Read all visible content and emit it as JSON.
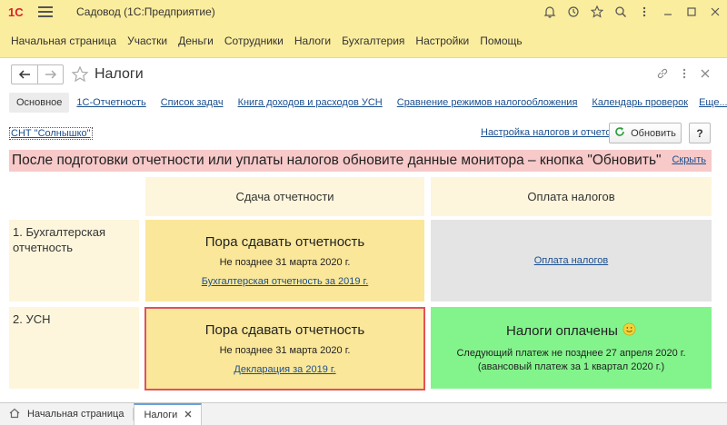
{
  "app": {
    "title": "Садовод  (1С:Предприятие)",
    "logo": "1C"
  },
  "section_nav": [
    "Начальная страница",
    "Участки",
    "Деньги",
    "Сотрудники",
    "Налоги",
    "Бухгалтерия",
    "Настройки",
    "Помощь"
  ],
  "form": {
    "title": "Налоги",
    "tabs": [
      {
        "label": "Основное",
        "active": true
      },
      {
        "label": "1С-Отчетность"
      },
      {
        "label": "Список задач"
      },
      {
        "label": "Книга доходов и расходов УСН"
      },
      {
        "label": "Сравнение режимов налогообложения"
      },
      {
        "label": "Календарь проверок"
      }
    ],
    "more_label": "Еще...",
    "organization": "СНТ \"Солнышко\"",
    "setup_link": "Настройка налогов и отчетов",
    "refresh_label": "Обновить",
    "help_label": "?"
  },
  "notice": {
    "text": "После подготовки отчетности или уплаты налогов обновите данные монитора – кнопка \"Обновить\"",
    "hide_label": "Скрыть",
    "color": "#f7c9c9"
  },
  "monitor": {
    "columns": [
      "Сдача отчетности",
      "Оплата налогов"
    ],
    "rows": [
      {
        "label": "1. Бухгалтерская отчетность",
        "reporting": {
          "title": "Пора сдавать отчетность",
          "deadline": "Не позднее 31 марта 2020 г.",
          "link": "Бухгалтерская отчетность за 2019 г.",
          "color": "#fbe79a"
        },
        "payment": {
          "link": "Оплата налогов",
          "color": "#e4e4e4"
        }
      },
      {
        "label": "2. УСН",
        "reporting": {
          "title": "Пора сдавать отчетность",
          "deadline": "Не позднее 31 марта 2020 г.",
          "link": "Декларация за 2019 г.",
          "color": "#fbe79a",
          "selected": true
        },
        "payment": {
          "title": "Налоги оплачены",
          "line1": "Следующий платеж не позднее 27 апреля 2020 г.",
          "line2": "(авансовый платеж за 1 квартал 2020 г.)",
          "icon": "smiley-icon",
          "color": "#83f48c"
        }
      }
    ]
  },
  "bottom_tabs": [
    {
      "label": "Начальная страница"
    },
    {
      "label": "Налоги",
      "active": true
    }
  ],
  "colors": {
    "accent": "#fbed9e",
    "link": "#1a4f8f",
    "selection": "#e0525a"
  }
}
